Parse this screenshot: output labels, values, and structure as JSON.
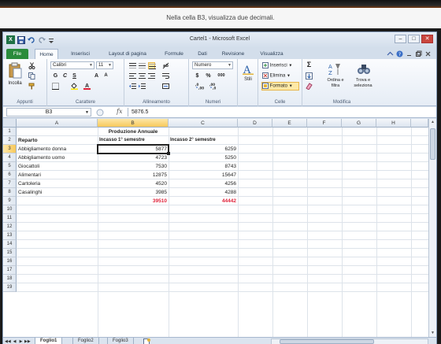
{
  "instruction": "Nella cella B3, visualizza due decimali.",
  "window": {
    "title": "Cartel1 - Microsoft Excel",
    "logo_letter": "X",
    "controls": [
      "–",
      "□",
      "✕"
    ]
  },
  "ribbon_tabs": [
    "File",
    "Home",
    "Inserisci",
    "Layout di pagina",
    "Formule",
    "Dati",
    "Revisione",
    "Visualizza"
  ],
  "active_tab": "Home",
  "ribbon": {
    "clipboard": {
      "paste_label": "Incolla",
      "group_label": "Appunti"
    },
    "font": {
      "font_name": "Calibri",
      "font_size": "11",
      "bold": "G",
      "italic": "C",
      "underline": "S",
      "grow": "A",
      "shrink": "A",
      "font_color": "A",
      "group_label": "Carattere"
    },
    "alignment": {
      "group_label": "Allineamento"
    },
    "number": {
      "format": "Numero",
      "currency": "$",
      "percent": "%",
      "thousands": "000",
      "group_label": "Numeri"
    },
    "styles": {
      "label": "Stili"
    },
    "cells": {
      "insert": "Inserisci",
      "delete": "Elimina",
      "format": "Formato",
      "group_label": "Celle"
    },
    "editing": {
      "sum": "Σ",
      "sort_label": "Ordina e filtra",
      "find_label": "Trova e seleziona",
      "group_label": "Modifica"
    }
  },
  "formula_bar": {
    "name_box": "B3",
    "fx": "fx",
    "content": "5876.5"
  },
  "columns": [
    "A",
    "B",
    "C",
    "D",
    "E",
    "F",
    "G",
    "H"
  ],
  "rows": [
    "1",
    "2",
    "3",
    "4",
    "5",
    "6",
    "7",
    "8",
    "9",
    "10",
    "11",
    "12",
    "13",
    "14",
    "15",
    "16",
    "17",
    "18",
    "19"
  ],
  "sheet": {
    "title": "Produzione Annuale",
    "header": {
      "reparto": "Reparto",
      "first": "Incasso 1° semestre",
      "second": "Incasso 2° semestre"
    },
    "data": [
      {
        "reparto": "Abbigliamento donna",
        "first": "5877",
        "second": "6259"
      },
      {
        "reparto": "Abbigliamento uomo",
        "first": "4723",
        "second": "5250"
      },
      {
        "reparto": "Giocattoli",
        "first": "7530",
        "second": "8743"
      },
      {
        "reparto": "Alimentari",
        "first": "12875",
        "second": "15647"
      },
      {
        "reparto": "Cartoleria",
        "first": "4520",
        "second": "4256"
      },
      {
        "reparto": "Casalinghi",
        "first": "3985",
        "second": "4288"
      }
    ],
    "totals": {
      "first": "39510",
      "second": "44442"
    }
  },
  "sheet_tabs": [
    "Foglio1",
    "Foglio2",
    "Foglio3"
  ],
  "colors": {
    "accent": "#1e7145",
    "selection": "#f7c85a",
    "total_red": "#e0233a"
  }
}
